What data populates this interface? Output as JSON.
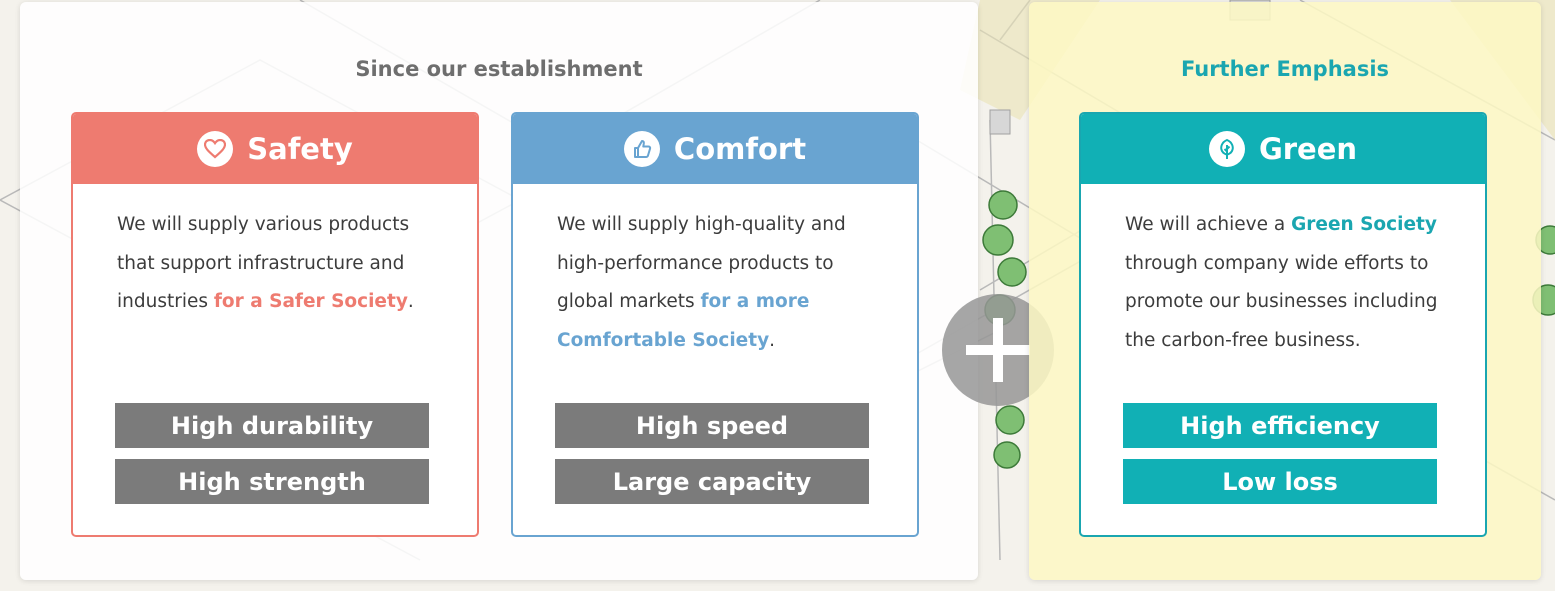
{
  "left_panel": {
    "heading": "Since our establishment"
  },
  "right_panel": {
    "heading": "Further Emphasis"
  },
  "cards": {
    "safety": {
      "title": "Safety",
      "icon": "heart-icon",
      "text_before": "We will supply various products that support infrastructure and industries ",
      "highlight": "for a Safer Society",
      "text_after": ".",
      "tags": [
        "High durability",
        "High strength"
      ],
      "color": "#ee7b70"
    },
    "comfort": {
      "title": "Comfort",
      "icon": "thumbs-up-icon",
      "text_before": "We will supply high-quality and high-performance products to global markets ",
      "highlight": "for a more Comfortable Society",
      "text_after": ".",
      "tags": [
        "High speed",
        "Large capacity"
      ],
      "color": "#69a4d1"
    },
    "green": {
      "title": "Green",
      "icon": "leaf-icon",
      "text_before": "We will achieve a ",
      "highlight": "Green Society",
      "text_after": " through company wide efforts to promote our businesses including the carbon-free business.",
      "tags": [
        "High efficiency",
        "Low loss"
      ],
      "color": "#11b0b5"
    }
  },
  "plus": {
    "icon": "plus-icon"
  }
}
